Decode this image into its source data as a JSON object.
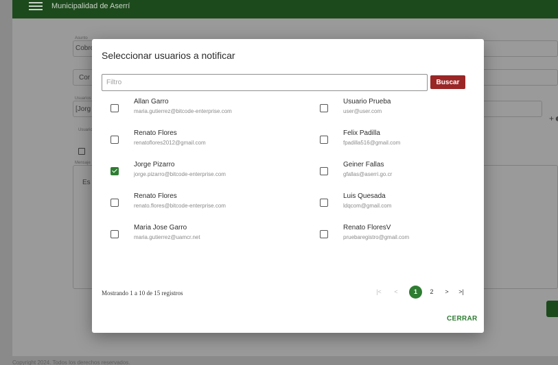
{
  "app": {
    "title": "Municipalidad de Aserrí"
  },
  "background_form": {
    "asunto_label": "Asunto",
    "asunto_value": "Cobro",
    "correo_value": "Cor",
    "usuarios_label": "Usuarios",
    "usuarios_value": "[Jorg",
    "usuarios2_label": "Usuario",
    "mensaje_label": "Mensaje",
    "mensaje_value": "Es",
    "copyright": "Copyright 2024. Todos los derechos reservados."
  },
  "modal": {
    "title": "Seleccionar usuarios a notificar",
    "filter_placeholder": "Filtro",
    "search_label": "Buscar",
    "users": [
      {
        "name": "Allan Garro",
        "email": "maria.gutierrez@bitcode-enterprise.com",
        "checked": false
      },
      {
        "name": "Usuario Prueba",
        "email": "user@user.com",
        "checked": false
      },
      {
        "name": "Renato Flores",
        "email": "renatoflores2012@gmail.com",
        "checked": false
      },
      {
        "name": "Felix Padilla",
        "email": "fpadilla516@gmail.com",
        "checked": false
      },
      {
        "name": "Jorge Pizarro",
        "email": "jorge.pizarro@bitcode-enterprise.com",
        "checked": true
      },
      {
        "name": "Geiner Fallas",
        "email": "gfallas@aserri.go.cr",
        "checked": false
      },
      {
        "name": "Renato Flores",
        "email": "renato.flores@bitcode-enterprise.com",
        "checked": false
      },
      {
        "name": "Luis Quesada",
        "email": "ldqcom@gmail.com",
        "checked": false
      },
      {
        "name": "Maria Jose Garro",
        "email": "maria.gutierrez@uamcr.net",
        "checked": false
      },
      {
        "name": "Renato FloresV",
        "email": "pruebaregistro@gmail.com",
        "checked": false
      }
    ],
    "pagination": {
      "info": "Mostrando 1 a 10 de 15 registros",
      "first": "|<",
      "prev": "<",
      "current_page": "1",
      "next_page": "2",
      "next": ">",
      "last": ">|"
    },
    "close_label": "CERRAR"
  },
  "colors": {
    "primary_green": "#2e7d32",
    "header_green": "#1d4a1c",
    "search_red": "#9a2626"
  }
}
